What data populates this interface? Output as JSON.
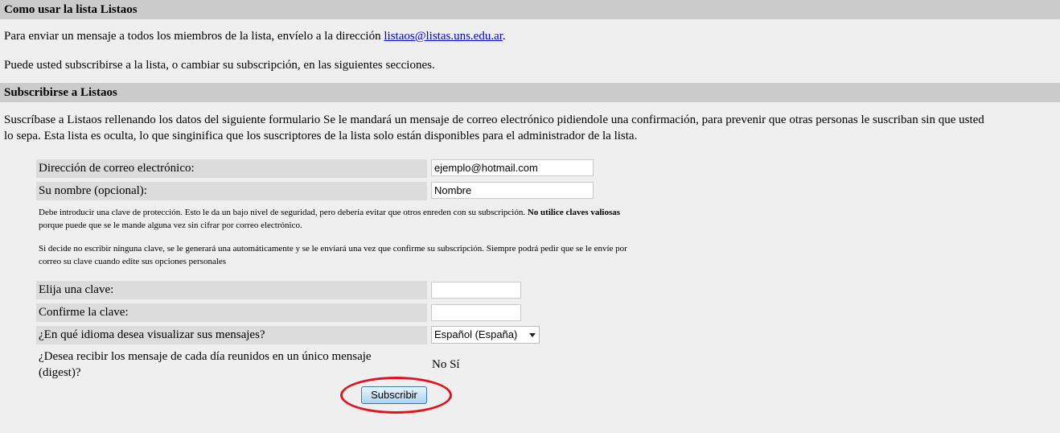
{
  "section1": {
    "title": "Como usar la lista Listaos",
    "p1_before": "Para enviar un mensaje a todos los miembros de la lista, envíelo a la dirección ",
    "p1_email": "listaos@listas.uns.edu.ar",
    "p1_after": ".",
    "p2": "Puede usted subscribirse a la lista, o cambiar su subscripción, en las siguientes secciones."
  },
  "section2": {
    "title": "Subscribirse a Listaos",
    "intro_line1": "Suscríbase a Listaos rellenando los datos del siguiente formulario Se le mandará un mensaje de correo electrónico pidiendole una confirmación, para prevenir que otras personas le suscriban sin que usted",
    "intro_line2": "lo sepa. Esta lista es oculta, lo que singinifica que los suscriptores de la lista solo están disponibles para el administrador de la lista."
  },
  "form": {
    "email_label": "Dirección de correo electrónico:",
    "email_value": "ejemplo@hotmail.com",
    "name_label": "Su nombre (opcional):",
    "name_value": "Nombre",
    "note1_line1_before": "Debe introducir una clave de protección. Esto le da un bajo nivel de seguridad, pero debería evitar que otros enreden con su subscripción. ",
    "note1_bold": "No utilice claves valiosas",
    "note1_line2": "porque puede que se le mande alguna vez sin cifrar por correo electrónico.",
    "note2_line1": "Si decide no escribir ninguna clave, se le generará una automáticamente y se le enviará una vez que confirme su subscripción. Siempre podrá pedir que se le envíe por",
    "note2_line2": "correo su clave cuando edite sus opciones personales",
    "password_label": "Elija una clave:",
    "password_value": "",
    "confirm_label": "Confirme la clave:",
    "confirm_value": "",
    "language_label": "¿En qué idioma desea visualizar sus mensajes?",
    "language_selected": "Español (España)",
    "digest_label_line1": "¿Desea recibir los mensaje de cada día reunidos en un único mensaje",
    "digest_label_line2": "(digest)?",
    "digest_no": "No",
    "digest_yes": "Sí",
    "submit_label": "Subscribir"
  },
  "colors": {
    "header_bar": "#cbcbcb",
    "label_bg": "#dcdcdc",
    "page_bg": "#efefef",
    "link": "#0000cc",
    "highlight_ring": "#e0141e"
  }
}
